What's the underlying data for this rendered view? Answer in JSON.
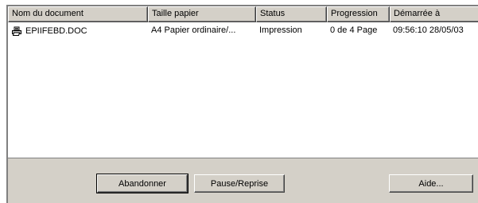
{
  "columns": [
    {
      "label": "Nom du document"
    },
    {
      "label": "Taille papier"
    },
    {
      "label": "Status"
    },
    {
      "label": "Progression"
    },
    {
      "label": "Démarrée à"
    }
  ],
  "rows": [
    {
      "icon": "printer-document-icon",
      "name": "EPIIFEBD.DOC",
      "paper": "A4 Papier ordinaire/...",
      "status": "Impression",
      "progress": "0 de 4 Page",
      "started": "09:56:10 28/05/03"
    }
  ],
  "buttons": {
    "abandon": {
      "mnemonic": "A",
      "rest": "bandonner"
    },
    "pause": {
      "mnemonic": "P",
      "rest": "ause/Reprise"
    },
    "help": {
      "pre": "A",
      "mnemonic": "i",
      "rest": "de..."
    }
  }
}
